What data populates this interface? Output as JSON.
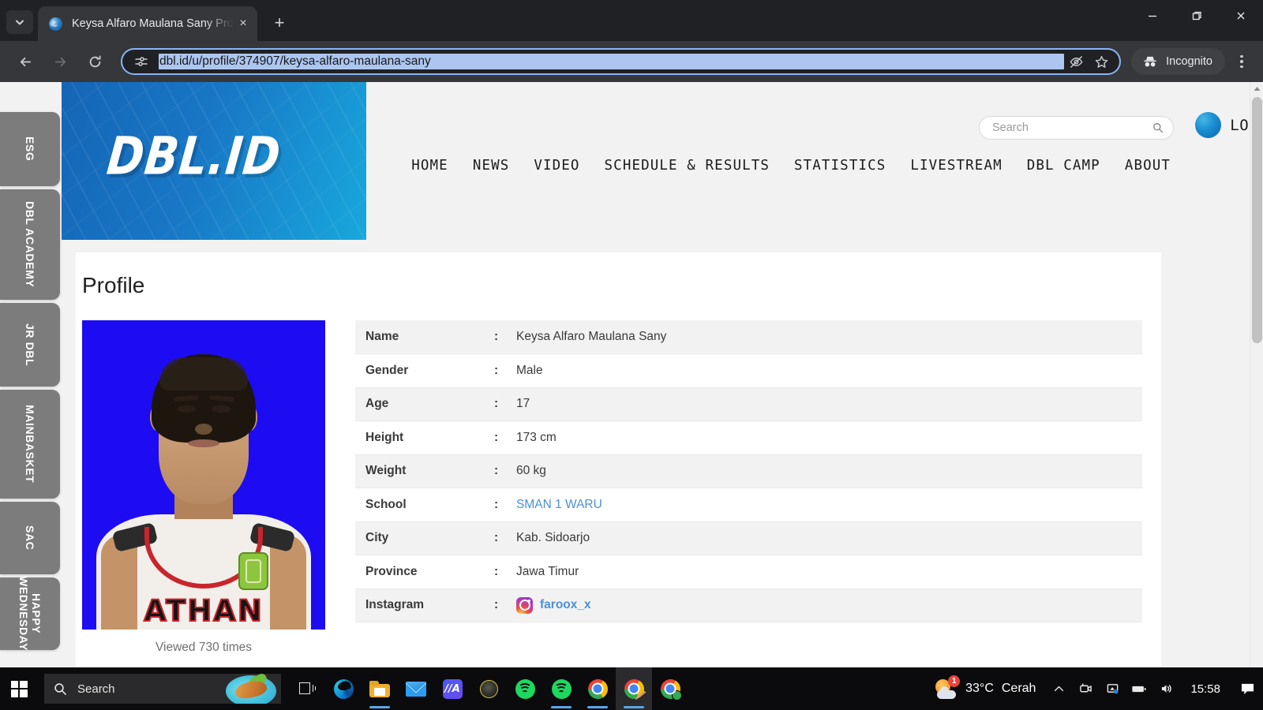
{
  "browser": {
    "tab": {
      "title": "Keysa Alfaro Maulana Sany Prof",
      "favicon": "globe-icon",
      "close": "×"
    },
    "new_tab": "+",
    "omnibox": {
      "url": "dbl.id/u/profile/374907/keysa-alfaro-maulana-sany",
      "site_info_icon": "tune-icon",
      "tracking_icon": "eye-off-icon",
      "bookmark_icon": "star-icon"
    },
    "profile_pill": {
      "label": "Incognito",
      "icon": "incognito-icon"
    },
    "window": {
      "minimize": "minimize-icon",
      "maximize": "restore-icon",
      "close": "close-icon"
    }
  },
  "side_tabs": [
    {
      "label": "ESG"
    },
    {
      "label": "DBL ACADEMY"
    },
    {
      "label": "JR DBL"
    },
    {
      "label": "MAINBASKET"
    },
    {
      "label": "SAC"
    },
    {
      "label": "HAPPY WEDNESDAY"
    }
  ],
  "site": {
    "logo": "DBL.ID",
    "search": {
      "placeholder": "Search",
      "value": "",
      "icon": "search-icon"
    },
    "login": {
      "label": "LOGIN"
    },
    "nav": [
      {
        "label": "HOME"
      },
      {
        "label": "NEWS"
      },
      {
        "label": "VIDEO"
      },
      {
        "label": "SCHEDULE & RESULTS"
      },
      {
        "label": "STATISTICS"
      },
      {
        "label": "LIVESTREAM"
      },
      {
        "label": "DBL CAMP"
      },
      {
        "label": "ABOUT"
      }
    ]
  },
  "page": {
    "title": "Profile",
    "photo": {
      "alt": "player-portrait",
      "jersey_text": "ATHAN"
    },
    "viewed": "Viewed 730 times",
    "separator": ":",
    "rows": [
      {
        "key": "Name",
        "value": "Keysa Alfaro Maulana Sany",
        "type": "text"
      },
      {
        "key": "Gender",
        "value": "Male",
        "type": "text"
      },
      {
        "key": "Age",
        "value": "17",
        "type": "text"
      },
      {
        "key": "Height",
        "value": "173 cm",
        "type": "text"
      },
      {
        "key": "Weight",
        "value": "60 kg",
        "type": "text"
      },
      {
        "key": "School",
        "value": "SMAN 1 WARU",
        "type": "link"
      },
      {
        "key": "City",
        "value": "Kab. Sidoarjo",
        "type": "text"
      },
      {
        "key": "Province",
        "value": "Jawa Timur",
        "type": "text"
      },
      {
        "key": "Instagram",
        "value": "faroox_x",
        "type": "instagram"
      }
    ]
  },
  "taskbar": {
    "start": "windows-logo-icon",
    "search": {
      "placeholder": "Search",
      "icon": "search-icon"
    },
    "task_view": "task-view-icon",
    "apps": [
      {
        "name": "edge-icon"
      },
      {
        "name": "file-explorer-icon"
      },
      {
        "name": "mail-icon"
      },
      {
        "name": "ma-app-icon"
      },
      {
        "name": "dark-circle-app-icon"
      },
      {
        "name": "spotify-icon"
      },
      {
        "name": "spotify-icon"
      },
      {
        "name": "chrome-icon"
      },
      {
        "name": "chrome-icon"
      },
      {
        "name": "chrome-icon"
      }
    ],
    "weather": {
      "temperature": "33°C",
      "condition": "Cerah",
      "badge": "1"
    },
    "tray": [
      {
        "name": "show-hidden-icons-chevron"
      },
      {
        "name": "meet-camera-icon"
      },
      {
        "name": "onedrive-icon"
      },
      {
        "name": "battery-icon"
      },
      {
        "name": "volume-icon"
      }
    ],
    "clock": "15:58",
    "notifications": "notification-icon"
  }
}
